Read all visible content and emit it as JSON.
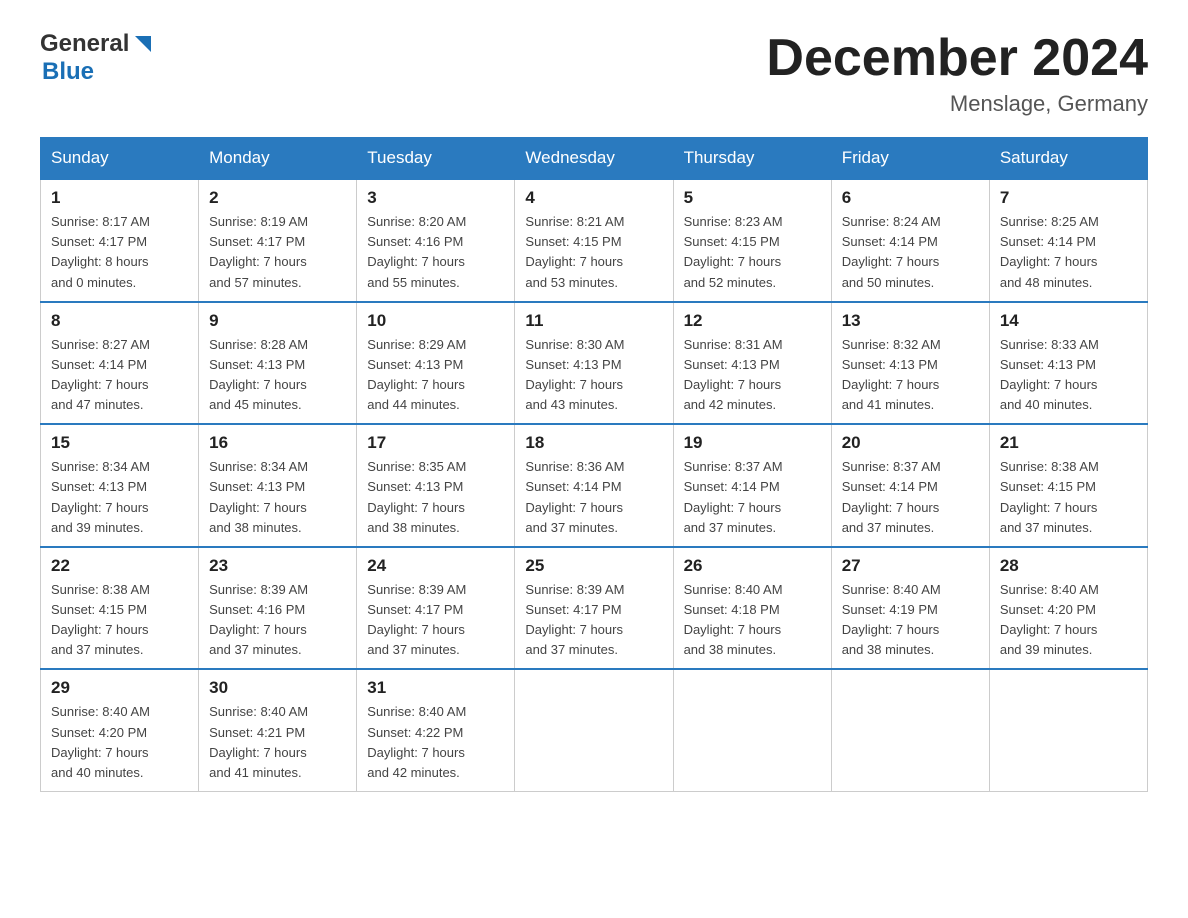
{
  "header": {
    "month_title": "December 2024",
    "location": "Menslage, Germany",
    "logo_general": "General",
    "logo_blue": "Blue"
  },
  "days_of_week": [
    "Sunday",
    "Monday",
    "Tuesday",
    "Wednesday",
    "Thursday",
    "Friday",
    "Saturday"
  ],
  "weeks": [
    {
      "days": [
        {
          "date": "1",
          "sunrise": "8:17 AM",
          "sunset": "4:17 PM",
          "daylight": "8 hours and 0 minutes."
        },
        {
          "date": "2",
          "sunrise": "8:19 AM",
          "sunset": "4:17 PM",
          "daylight": "7 hours and 57 minutes."
        },
        {
          "date": "3",
          "sunrise": "8:20 AM",
          "sunset": "4:16 PM",
          "daylight": "7 hours and 55 minutes."
        },
        {
          "date": "4",
          "sunrise": "8:21 AM",
          "sunset": "4:15 PM",
          "daylight": "7 hours and 53 minutes."
        },
        {
          "date": "5",
          "sunrise": "8:23 AM",
          "sunset": "4:15 PM",
          "daylight": "7 hours and 52 minutes."
        },
        {
          "date": "6",
          "sunrise": "8:24 AM",
          "sunset": "4:14 PM",
          "daylight": "7 hours and 50 minutes."
        },
        {
          "date": "7",
          "sunrise": "8:25 AM",
          "sunset": "4:14 PM",
          "daylight": "7 hours and 48 minutes."
        }
      ]
    },
    {
      "days": [
        {
          "date": "8",
          "sunrise": "8:27 AM",
          "sunset": "4:14 PM",
          "daylight": "7 hours and 47 minutes."
        },
        {
          "date": "9",
          "sunrise": "8:28 AM",
          "sunset": "4:13 PM",
          "daylight": "7 hours and 45 minutes."
        },
        {
          "date": "10",
          "sunrise": "8:29 AM",
          "sunset": "4:13 PM",
          "daylight": "7 hours and 44 minutes."
        },
        {
          "date": "11",
          "sunrise": "8:30 AM",
          "sunset": "4:13 PM",
          "daylight": "7 hours and 43 minutes."
        },
        {
          "date": "12",
          "sunrise": "8:31 AM",
          "sunset": "4:13 PM",
          "daylight": "7 hours and 42 minutes."
        },
        {
          "date": "13",
          "sunrise": "8:32 AM",
          "sunset": "4:13 PM",
          "daylight": "7 hours and 41 minutes."
        },
        {
          "date": "14",
          "sunrise": "8:33 AM",
          "sunset": "4:13 PM",
          "daylight": "7 hours and 40 minutes."
        }
      ]
    },
    {
      "days": [
        {
          "date": "15",
          "sunrise": "8:34 AM",
          "sunset": "4:13 PM",
          "daylight": "7 hours and 39 minutes."
        },
        {
          "date": "16",
          "sunrise": "8:34 AM",
          "sunset": "4:13 PM",
          "daylight": "7 hours and 38 minutes."
        },
        {
          "date": "17",
          "sunrise": "8:35 AM",
          "sunset": "4:13 PM",
          "daylight": "7 hours and 38 minutes."
        },
        {
          "date": "18",
          "sunrise": "8:36 AM",
          "sunset": "4:14 PM",
          "daylight": "7 hours and 37 minutes."
        },
        {
          "date": "19",
          "sunrise": "8:37 AM",
          "sunset": "4:14 PM",
          "daylight": "7 hours and 37 minutes."
        },
        {
          "date": "20",
          "sunrise": "8:37 AM",
          "sunset": "4:14 PM",
          "daylight": "7 hours and 37 minutes."
        },
        {
          "date": "21",
          "sunrise": "8:38 AM",
          "sunset": "4:15 PM",
          "daylight": "7 hours and 37 minutes."
        }
      ]
    },
    {
      "days": [
        {
          "date": "22",
          "sunrise": "8:38 AM",
          "sunset": "4:15 PM",
          "daylight": "7 hours and 37 minutes."
        },
        {
          "date": "23",
          "sunrise": "8:39 AM",
          "sunset": "4:16 PM",
          "daylight": "7 hours and 37 minutes."
        },
        {
          "date": "24",
          "sunrise": "8:39 AM",
          "sunset": "4:17 PM",
          "daylight": "7 hours and 37 minutes."
        },
        {
          "date": "25",
          "sunrise": "8:39 AM",
          "sunset": "4:17 PM",
          "daylight": "7 hours and 37 minutes."
        },
        {
          "date": "26",
          "sunrise": "8:40 AM",
          "sunset": "4:18 PM",
          "daylight": "7 hours and 38 minutes."
        },
        {
          "date": "27",
          "sunrise": "8:40 AM",
          "sunset": "4:19 PM",
          "daylight": "7 hours and 38 minutes."
        },
        {
          "date": "28",
          "sunrise": "8:40 AM",
          "sunset": "4:20 PM",
          "daylight": "7 hours and 39 minutes."
        }
      ]
    },
    {
      "days": [
        {
          "date": "29",
          "sunrise": "8:40 AM",
          "sunset": "4:20 PM",
          "daylight": "7 hours and 40 minutes."
        },
        {
          "date": "30",
          "sunrise": "8:40 AM",
          "sunset": "4:21 PM",
          "daylight": "7 hours and 41 minutes."
        },
        {
          "date": "31",
          "sunrise": "8:40 AM",
          "sunset": "4:22 PM",
          "daylight": "7 hours and 42 minutes."
        },
        null,
        null,
        null,
        null
      ]
    }
  ],
  "labels": {
    "sunrise": "Sunrise:",
    "sunset": "Sunset:",
    "daylight": "Daylight:"
  }
}
